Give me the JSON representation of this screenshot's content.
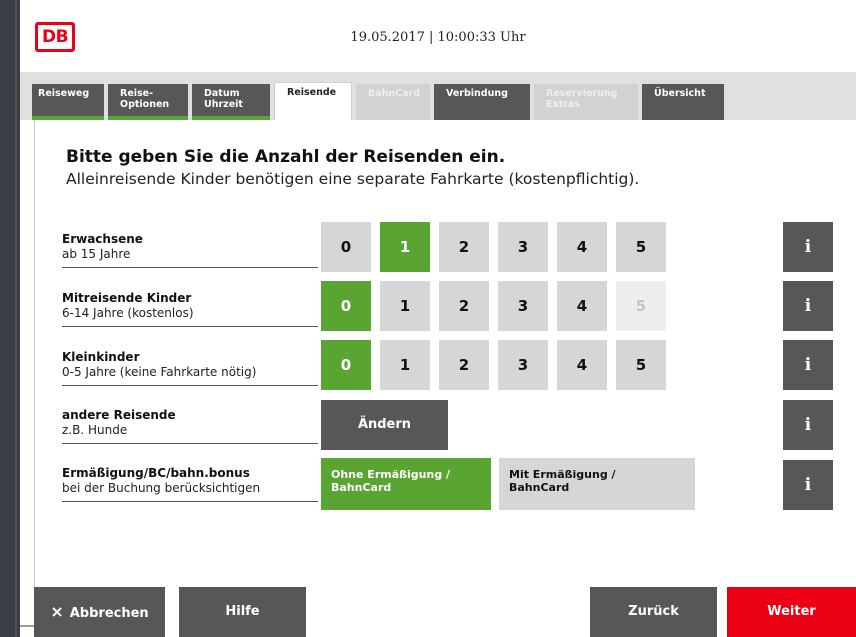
{
  "header": {
    "datetime": "19.05.2017 | 10:00:33 Uhr",
    "logo": "DB"
  },
  "tabs": [
    {
      "line1": "Reiseweg",
      "line2": "",
      "state": "done"
    },
    {
      "line1": "Reise-",
      "line2": "Optionen",
      "state": "done"
    },
    {
      "line1": "Datum",
      "line2": "Uhrzeit",
      "state": "done"
    },
    {
      "line1": "Reisende",
      "line2": "",
      "state": "active"
    },
    {
      "line1": "BahnCard",
      "line2": "",
      "state": "disabled"
    },
    {
      "line1": "Verbindung",
      "line2": "",
      "state": "pending"
    },
    {
      "line1": "Reservierung",
      "line2": "Extras",
      "state": "disabled"
    },
    {
      "line1": "Übersicht",
      "line2": "",
      "state": "pending"
    }
  ],
  "main": {
    "headline": "Bitte geben Sie die Anzahl der Reisenden ein.",
    "subline": "Alleinreisende Kinder benötigen eine separate Fahrkarte (kostenpflichtig).",
    "rows": [
      {
        "title": "Erwachsene",
        "subtitle": "ab 15 Jahre",
        "options": [
          "0",
          "1",
          "2",
          "3",
          "4",
          "5"
        ],
        "selected": 1
      },
      {
        "title": "Mitreisende Kinder",
        "subtitle": "6-14 Jahre (kostenlos)",
        "options": [
          "0",
          "1",
          "2",
          "3",
          "4",
          "5"
        ],
        "selected": 0,
        "disabled": [
          5
        ]
      },
      {
        "title": "Kleinkinder",
        "subtitle": "0-5 Jahre (keine Fahrkarte nötig)",
        "options": [
          "0",
          "1",
          "2",
          "3",
          "4",
          "5"
        ],
        "selected": 0
      },
      {
        "title": "andere Reisende",
        "subtitle": "z.B. Hunde"
      },
      {
        "title": "Ermäßigung/BC/bahn.bonus",
        "subtitle": "bei der Buchung berücksichtigen"
      }
    ],
    "change_label": "Ändern",
    "info_label": "i",
    "discount_options": [
      {
        "line1": "Ohne Ermäßigung /",
        "line2": "BahnCard",
        "selected": true
      },
      {
        "line1": "Mit Ermäßigung /",
        "line2": "BahnCard",
        "selected": false
      }
    ]
  },
  "footer": {
    "cancel": "Abbrechen",
    "cancel_icon": "×",
    "help": "Hilfe",
    "back": "Zurück",
    "next": "Weiter"
  },
  "colors": {
    "db_red": "#ec0016",
    "selected_green": "#5aa431",
    "dark_button": "#575757",
    "light_button": "#d6d6d6"
  }
}
